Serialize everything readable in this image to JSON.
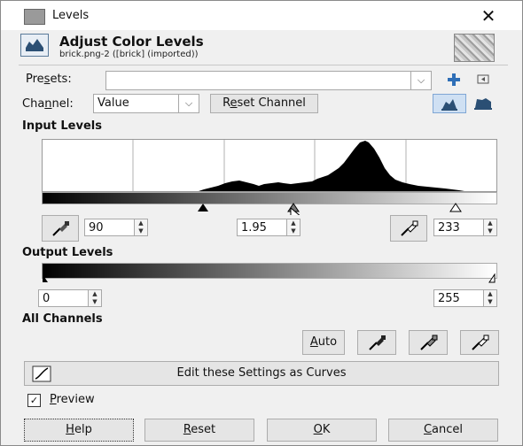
{
  "window": {
    "title": "Levels",
    "app_icon": "gimp-dialog-icon",
    "close_icon": "close-icon"
  },
  "header": {
    "title": "Adjust Color Levels",
    "subtitle": "brick.png-2 ([brick] (imported))",
    "icon": "levels-icon",
    "thumbnail": "image-thumbnail"
  },
  "presets": {
    "label_pre": "Pre",
    "label_u": "s",
    "label_post": "ets:",
    "value": "",
    "add_icon": "plus-icon",
    "menu_icon": "preset-menu-icon"
  },
  "channel": {
    "label_pre": "Cha",
    "label_u": "n",
    "label_post": "nel:",
    "value": "Value",
    "reset_pre": "R",
    "reset_u": "e",
    "reset_post": "set Channel",
    "linear_icon": "linear-histogram-icon",
    "log_icon": "log-histogram-icon"
  },
  "input_levels": {
    "title": "Input Levels",
    "low": "90",
    "gamma": "1.95",
    "high": "233"
  },
  "output_levels": {
    "title": "Output Levels",
    "low": "0",
    "high": "255"
  },
  "all_channels": {
    "title": "All Channels",
    "auto_u": "A",
    "auto_post": "uto"
  },
  "curves_button": {
    "label": "Edit these Settings as Curves"
  },
  "preview": {
    "label_u": "P",
    "label_post": "review",
    "checked": true,
    "check_glyph": "✓"
  },
  "buttons": {
    "help_u": "H",
    "help_post": "elp",
    "reset_u": "R",
    "reset_post": "eset",
    "ok_u": "O",
    "ok_post": "K",
    "cancel_u": "C",
    "cancel_post": "ancel"
  }
}
